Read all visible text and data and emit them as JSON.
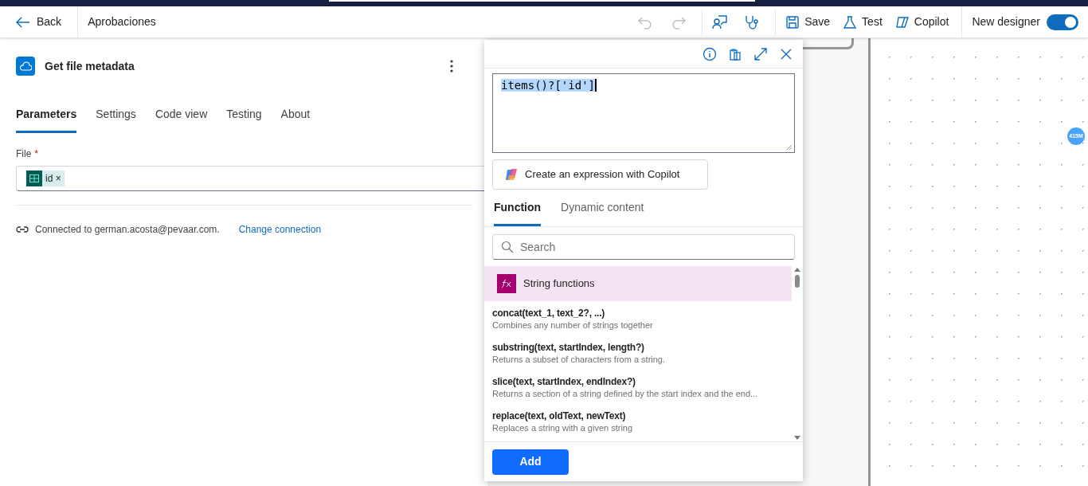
{
  "toolbar": {
    "back": "Back",
    "flow_name": "Aprobaciones",
    "icon_buttons": [
      {
        "kind": "undo",
        "disabled": true
      },
      {
        "kind": "redo",
        "disabled": true
      },
      {
        "kind": "feedback",
        "disabled": false
      },
      {
        "kind": "checker",
        "disabled": false
      }
    ],
    "buttons": [
      {
        "kind": "save",
        "label": "Save"
      },
      {
        "kind": "test",
        "label": "Test"
      },
      {
        "kind": "copilot",
        "label": "Copilot"
      }
    ],
    "toggle": {
      "label": "New designer",
      "on": true
    }
  },
  "action_panel": {
    "title": "Get file metadata",
    "tabs": [
      {
        "label": "Parameters",
        "selected": true
      },
      {
        "label": "Settings",
        "selected": false
      },
      {
        "label": "Code view",
        "selected": false
      },
      {
        "label": "Testing",
        "selected": false
      },
      {
        "label": "About",
        "selected": false
      }
    ],
    "file_field": {
      "label": "File",
      "required_mark": "*",
      "token": "id ×"
    },
    "connection": {
      "text": "Connected to german.acosta@pevaar.com.",
      "link": "Change connection"
    }
  },
  "expression_editor": {
    "expression": "items()?['id']",
    "copilot_button": "Create an expression with Copilot",
    "tabs": [
      {
        "label": "Function",
        "selected": true
      },
      {
        "label": "Dynamic content",
        "selected": false
      }
    ],
    "search": {
      "placeholder": "Search"
    },
    "category": "String functions",
    "functions": [
      {
        "name": "concat(text_1, text_2?, ...)",
        "description": "Combines any number of strings together"
      },
      {
        "name": "substring(text, startIndex, length?)",
        "description": "Returns a subset of characters from a string."
      },
      {
        "name": "slice(text, startIndex, endIndex?)",
        "description": "Returns a section of a string defined by the start index and the end..."
      },
      {
        "name": "replace(text, oldText, newText)",
        "description": "Replaces a string with a given string"
      }
    ],
    "add_button": "Add"
  },
  "canvas": {
    "badge": "415M"
  }
}
